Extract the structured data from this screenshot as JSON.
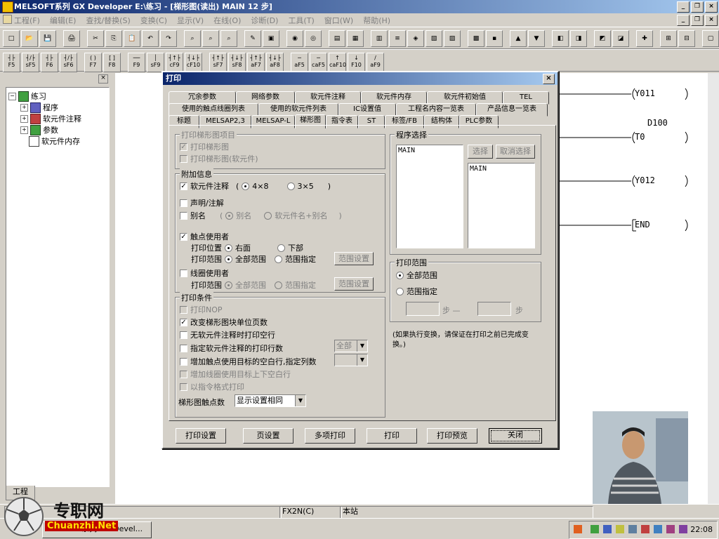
{
  "window": {
    "title": "MELSOFT系列 GX Developer E:\\练习 - [梯形图(读出)   MAIN  12 步]"
  },
  "menu": [
    "工程(F)",
    "编辑(E)",
    "查找/替换(S)",
    "变换(C)",
    "显示(V)",
    "在线(O)",
    "诊断(D)",
    "工具(T)",
    "窗口(W)",
    "帮助(H)"
  ],
  "fkeys": [
    "F5",
    "sF5",
    "F6",
    "sF6",
    "F7",
    "F8",
    "F9",
    "sF9",
    "cF9",
    "cF10",
    "sF7",
    "sF8",
    "aF7",
    "aF8",
    "aF5",
    "caF5",
    "caF10",
    "F10",
    "aF9"
  ],
  "project": {
    "root": "练习",
    "items": [
      "程序",
      "软元件注释",
      "参数",
      "软元件内存"
    ],
    "tab": "工程"
  },
  "ladder": {
    "coils": [
      "Y011",
      "T0",
      "Y012",
      "END"
    ],
    "k_value": "D100"
  },
  "dialog": {
    "title": "打印",
    "tabs_row1": [
      "冗余参数",
      "网络参数",
      "软元件注释",
      "软元件内存",
      "软元件初始值",
      "TEL"
    ],
    "tabs_row2": [
      "使用的触点线圈列表",
      "使用的软元件列表",
      "IC设置值",
      "工程名内容一览表",
      "产品信息一览表"
    ],
    "tabs_row3": [
      "标题",
      "MELSAP2,3",
      "MELSAP-L",
      "梯形图",
      "指令表",
      "ST",
      "标签/FB",
      "结构体",
      "PLC参数"
    ],
    "print_target": {
      "title": "打印梯形图项目",
      "opt1": "打印梯形图",
      "opt2": "打印梯形图(软元件)"
    },
    "additional": {
      "title": "附加信息",
      "comment": "软元件注释",
      "size_4x8": "4×8",
      "size_3x5": "3×5",
      "stmt": "声明/注解",
      "alias": "别名",
      "alias_opt1": "别名",
      "alias_opt2": "软元件名+别名",
      "contact_use": "触点使用者",
      "pos_label": "打印位置",
      "pos_right": "右面",
      "pos_bottom": "下部",
      "range_label": "打印范围",
      "range_all": "全部范围",
      "range_spec": "范围指定",
      "range_btn": "范围设置",
      "coil_use": "线圈使用者",
      "coil_range_label": "打印范围",
      "coil_range_all": "全部范围",
      "coil_range_spec": "范围指定",
      "coil_range_btn": "范围设置"
    },
    "conditions": {
      "title": "打印条件",
      "c1": "打印NOP",
      "c2": "改变梯形图块单位页数",
      "c3": "无软元件注释时打印空行",
      "c4": "指定软元件注释的打印行数",
      "c4_value": "全部",
      "c5": "增加触点使用目标的空白行,指定列数",
      "c6": "增加线圈使用目标上下空白行",
      "c7": "以指令格式打印",
      "contacts_label": "梯形图触点数",
      "contacts_value": "显示设置相同"
    },
    "program": {
      "title": "程序选择",
      "left_items": [
        "MAIN"
      ],
      "right_items": [
        "MAIN"
      ],
      "select_btn": "选择",
      "cancel_btn": "取消选择"
    },
    "range": {
      "title": "打印范围",
      "all": "全部范围",
      "spec": "范围指定",
      "step_from": "步 —",
      "step_to": "步"
    },
    "note": "(如果执行变换，请保证在打印之前已完成变换。)",
    "buttons": [
      "打印设置",
      "页设置",
      "多项打印",
      "打印",
      "打印预览",
      "关闭"
    ]
  },
  "status": {
    "plc": "FX2N(C)",
    "station": "本站"
  },
  "taskbar": {
    "task": "MELSOFT系列 GX Devel...",
    "clock": "22:08"
  },
  "watermark": {
    "cn": "专职网",
    "en": "Chuanzhi.Net"
  }
}
